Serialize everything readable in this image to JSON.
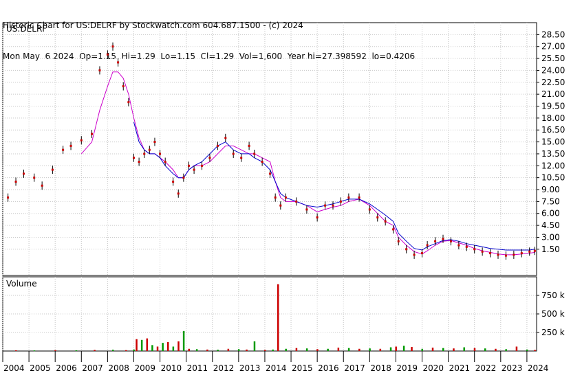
{
  "header": {
    "line1": "Historic Chart for US:DELRF by Stockwatch.com 604.687.1500 - (c) 2024",
    "line2": "Mon May  6 2024  Op=1.15  Hi=1.29  Lo=1.15  Cl=1.29  Vol=1,600  Year hi=27.398592  lo=0.4206"
  },
  "colors": {
    "price": "#cc0000",
    "bars": "#000000",
    "ma_short": "#cc00cc",
    "ma_long": "#0000cc",
    "vol_main": "#cc0000",
    "vol_alt": "#009900",
    "grid": "#c8c8c8"
  },
  "chart_data": [
    {
      "type": "line",
      "title": "US:DELRF",
      "ylim": [
        -1.8,
        30.0
      ],
      "y_ticks": [
        "28.50",
        "27.00",
        "25.50",
        "24.00",
        "22.50",
        "21.00",
        "19.50",
        "18.00",
        "16.50",
        "15.00",
        "13.50",
        "12.00",
        "10.50",
        "9.00",
        "7.50",
        "6.00",
        "4.50",
        "3.00",
        "1.50"
      ],
      "x_ticks": [
        "2004",
        "2005",
        "2006",
        "2007",
        "2008",
        "2009",
        "2010",
        "2011",
        "2012",
        "2013",
        "2014",
        "2015",
        "2016",
        "2017",
        "2018",
        "2019",
        "2020",
        "2021",
        "2022",
        "2023",
        "2024"
      ],
      "price_x": [
        2004.2,
        2004.5,
        2004.8,
        2005.2,
        2005.5,
        2005.9,
        2006.3,
        2006.6,
        2007.0,
        2007.4,
        2007.7,
        2008.0,
        2008.2,
        2008.4,
        2008.6,
        2008.8,
        2009.0,
        2009.2,
        2009.4,
        2009.6,
        2009.8,
        2010.0,
        2010.2,
        2010.5,
        2010.7,
        2010.9,
        2011.1,
        2011.3,
        2011.6,
        2011.9,
        2012.2,
        2012.5,
        2012.8,
        2013.1,
        2013.4,
        2013.6,
        2013.9,
        2014.2,
        2014.4,
        2014.6,
        2014.8,
        2015.2,
        2015.6,
        2016.0,
        2016.3,
        2016.6,
        2016.9,
        2017.2,
        2017.6,
        2018.0,
        2018.3,
        2018.6,
        2018.9,
        2019.1,
        2019.4,
        2019.7,
        2020.0,
        2020.2,
        2020.5,
        2020.8,
        2021.1,
        2021.4,
        2021.7,
        2022.0,
        2022.3,
        2022.6,
        2022.9,
        2023.2,
        2023.5,
        2023.8,
        2024.1,
        2024.3
      ],
      "series": [
        {
          "values": [
            8.0,
            10.0,
            11.0,
            10.5,
            9.5,
            11.5,
            14.0,
            14.5,
            15.2,
            16.0,
            24.0,
            26.0,
            27.0,
            25.0,
            22.0,
            20.0,
            13.0,
            12.5,
            13.5,
            14.0,
            15.0,
            13.5,
            12.5,
            10.0,
            8.5,
            10.5,
            12.0,
            11.5,
            12.0,
            13.0,
            14.5,
            15.5,
            13.5,
            13.0,
            14.5,
            13.5,
            12.5,
            11.0,
            8.0,
            7.0,
            8.0,
            7.5,
            6.5,
            5.5,
            7.0,
            7.0,
            7.5,
            8.0,
            8.0,
            6.5,
            5.5,
            5.0,
            4.0,
            2.5,
            1.5,
            0.8,
            1.0,
            2.0,
            2.5,
            2.8,
            2.5,
            2.0,
            1.8,
            1.5,
            1.2,
            1.0,
            0.8,
            0.7,
            0.8,
            1.0,
            1.2,
            1.29
          ]
        },
        {
          "values": [
            null,
            null,
            null,
            null,
            null,
            null,
            null,
            null,
            13.5,
            15.0,
            19.0,
            22.0,
            23.8,
            23.8,
            23.0,
            21.0,
            18.0,
            15.5,
            14.0,
            13.5,
            13.5,
            13.0,
            12.5,
            11.5,
            10.5,
            10.5,
            11.5,
            12.0,
            12.0,
            12.5,
            13.5,
            14.5,
            14.5,
            14.0,
            13.5,
            13.5,
            13.0,
            12.5,
            10.0,
            8.0,
            7.5,
            7.5,
            7.0,
            6.2,
            6.5,
            6.8,
            7.0,
            7.5,
            7.8,
            7.0,
            6.0,
            5.0,
            4.5,
            3.0,
            2.0,
            1.2,
            0.9,
            1.3,
            2.0,
            2.5,
            2.6,
            2.3,
            2.0,
            1.6,
            1.3,
            1.1,
            0.9,
            0.8,
            0.8,
            0.9,
            1.0,
            1.1
          ]
        },
        {
          "values": [
            null,
            null,
            null,
            null,
            null,
            null,
            null,
            null,
            null,
            null,
            null,
            null,
            null,
            null,
            null,
            null,
            17.5,
            15.0,
            14.0,
            13.5,
            13.5,
            13.0,
            12.0,
            11.0,
            10.5,
            10.5,
            11.5,
            12.0,
            12.5,
            13.5,
            14.5,
            15.0,
            14.0,
            13.5,
            13.5,
            13.0,
            12.5,
            11.5,
            10.0,
            8.5,
            8.0,
            7.5,
            7.0,
            6.8,
            7.0,
            7.2,
            7.5,
            7.8,
            7.8,
            7.2,
            6.5,
            5.8,
            5.0,
            3.5,
            2.5,
            1.6,
            1.4,
            1.8,
            2.2,
            2.6,
            2.7,
            2.5,
            2.2,
            2.0,
            1.8,
            1.6,
            1.5,
            1.4,
            1.4,
            1.4,
            1.4,
            1.5
          ]
        }
      ]
    },
    {
      "type": "bar",
      "title": "Volume",
      "ylim": [
        0,
        1000
      ],
      "y_ticks": [
        "750 k",
        "500 k",
        "250 k"
      ],
      "x": [
        2004.5,
        2005.2,
        2006.0,
        2006.8,
        2007.5,
        2008.2,
        2008.7,
        2009.0,
        2009.1,
        2009.3,
        2009.5,
        2009.7,
        2009.9,
        2010.1,
        2010.3,
        2010.5,
        2010.7,
        2010.9,
        2011.1,
        2011.4,
        2011.8,
        2012.2,
        2012.6,
        2013.0,
        2013.3,
        2013.6,
        2014.0,
        2014.3,
        2014.5,
        2014.8,
        2015.2,
        2015.6,
        2016.0,
        2016.4,
        2016.8,
        2017.2,
        2017.6,
        2018.0,
        2018.4,
        2018.8,
        2019.0,
        2019.3,
        2019.6,
        2020.0,
        2020.4,
        2020.8,
        2021.2,
        2021.6,
        2022.0,
        2022.4,
        2022.8,
        2023.2,
        2023.6,
        2024.0,
        2024.3
      ],
      "values": [
        10,
        8,
        12,
        10,
        15,
        18,
        12,
        20,
        160,
        150,
        170,
        80,
        60,
        110,
        120,
        60,
        130,
        270,
        30,
        25,
        20,
        18,
        30,
        25,
        20,
        130,
        15,
        20,
        900,
        30,
        40,
        35,
        25,
        30,
        45,
        40,
        30,
        35,
        30,
        50,
        60,
        70,
        55,
        30,
        45,
        40,
        35,
        50,
        40,
        35,
        30,
        25,
        60,
        20,
        15
      ]
    }
  ]
}
